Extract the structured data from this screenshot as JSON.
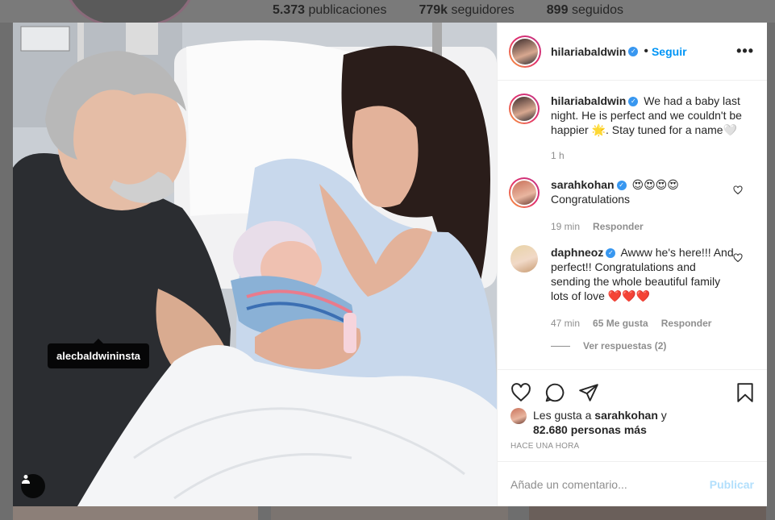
{
  "profile_bg": {
    "stats": [
      {
        "value": "5.373",
        "label": "publicaciones"
      },
      {
        "value": "779k",
        "label": "seguidores"
      },
      {
        "value": "899",
        "label": "seguidos"
      }
    ]
  },
  "post": {
    "author": "hilariabaldwin",
    "follow_label": "Seguir",
    "dot": "•",
    "more_label": "•••",
    "photo_tag": "alecbaldwininsta",
    "caption": {
      "user": "hilariabaldwin",
      "text": "We had a baby last night. He is perfect and we couldn't be happier 🌟. Stay tuned for a name🤍",
      "time": "1 h"
    },
    "comments": [
      {
        "user": "sarahkohan",
        "text": "😍😍😍😍",
        "text2": "Congratulations",
        "time": "19 min",
        "reply_label": "Responder"
      },
      {
        "user": "daphneoz",
        "text": "Awww he's here!!! And perfect!! Congratulations and sending the whole beautiful family lots of love ❤️❤️❤️",
        "time": "47 min",
        "likes": "65 Me gusta",
        "reply_label": "Responder",
        "view_replies": "Ver respuestas (2)"
      }
    ],
    "likes_line1_prefix": "Les gusta a",
    "likes_user": "sarahkohan",
    "likes_line1_suffix": "y",
    "likes_count": "82.680 personas más",
    "timestamp": "HACE UNA HORA",
    "comment_placeholder": "Añade un comentario...",
    "publish_label": "Publicar"
  },
  "colors": {
    "accent": "#0095f6",
    "verified": "#3897f0",
    "publish_disabled": "#b2dffc"
  },
  "icons": [
    "heart-icon",
    "comment-icon",
    "share-icon",
    "bookmark-icon",
    "user-tag-icon",
    "verified-icon",
    "more-icon"
  ]
}
